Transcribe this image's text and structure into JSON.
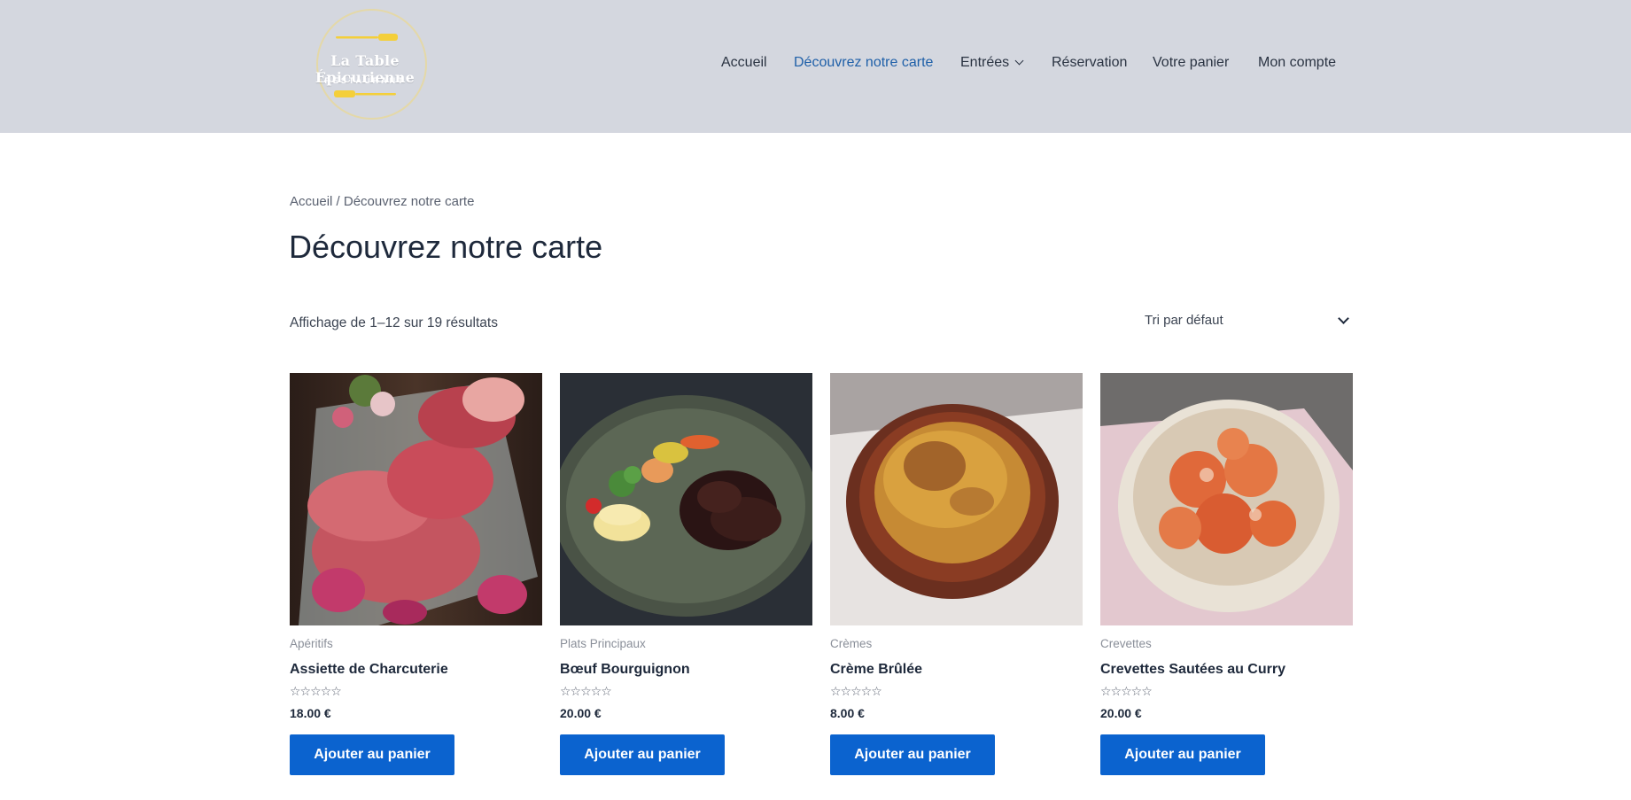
{
  "brand": {
    "name": "La Table Épicurienne",
    "tagline": "RESTAURANT",
    "accent_color": "#f4cf3a"
  },
  "nav": {
    "items": [
      {
        "label": "Accueil",
        "active": false
      },
      {
        "label": "Découvrez notre carte",
        "active": true
      },
      {
        "label": "Entrées",
        "active": false,
        "has_dropdown": true
      },
      {
        "label": "Réservation",
        "active": false
      },
      {
        "label": "Votre panier",
        "active": false
      },
      {
        "label": "Mon compte",
        "active": false
      }
    ],
    "active_color": "#1e5fa8"
  },
  "breadcrumb": {
    "home": "Accueil",
    "separator": " / ",
    "current": "Découvrez notre carte"
  },
  "page": {
    "title": "Découvrez notre carte",
    "result_count": "Affichage de 1–12 sur 19 résultats",
    "sort": {
      "selected": "Tri par défaut",
      "icon": "chevron-down-icon"
    }
  },
  "products": [
    {
      "category": "Apéritifs",
      "name": "Assiette de Charcuterie",
      "rating": 0,
      "stars": "☆☆☆☆☆",
      "price": "18.00 €",
      "button": "Ajouter au panier",
      "image": "charcuterie-platter"
    },
    {
      "category": "Plats Principaux",
      "name": "Bœuf Bourguignon",
      "rating": 0,
      "stars": "☆☆☆☆☆",
      "price": "20.00 €",
      "button": "Ajouter au panier",
      "image": "beef-stew-plate"
    },
    {
      "category": "Crèmes",
      "name": "Crème Brûlée",
      "rating": 0,
      "stars": "☆☆☆☆☆",
      "price": "8.00 €",
      "button": "Ajouter au panier",
      "image": "creme-brulee-dish"
    },
    {
      "category": "Crevettes",
      "name": "Crevettes Sautées au Curry",
      "rating": 0,
      "stars": "☆☆☆☆☆",
      "price": "20.00 €",
      "button": "Ajouter au panier",
      "image": "curry-shrimp-bowl"
    }
  ],
  "colors": {
    "header_bg": "#d4d7df",
    "button_bg": "#0b63cf",
    "title_text": "#1e293b"
  }
}
